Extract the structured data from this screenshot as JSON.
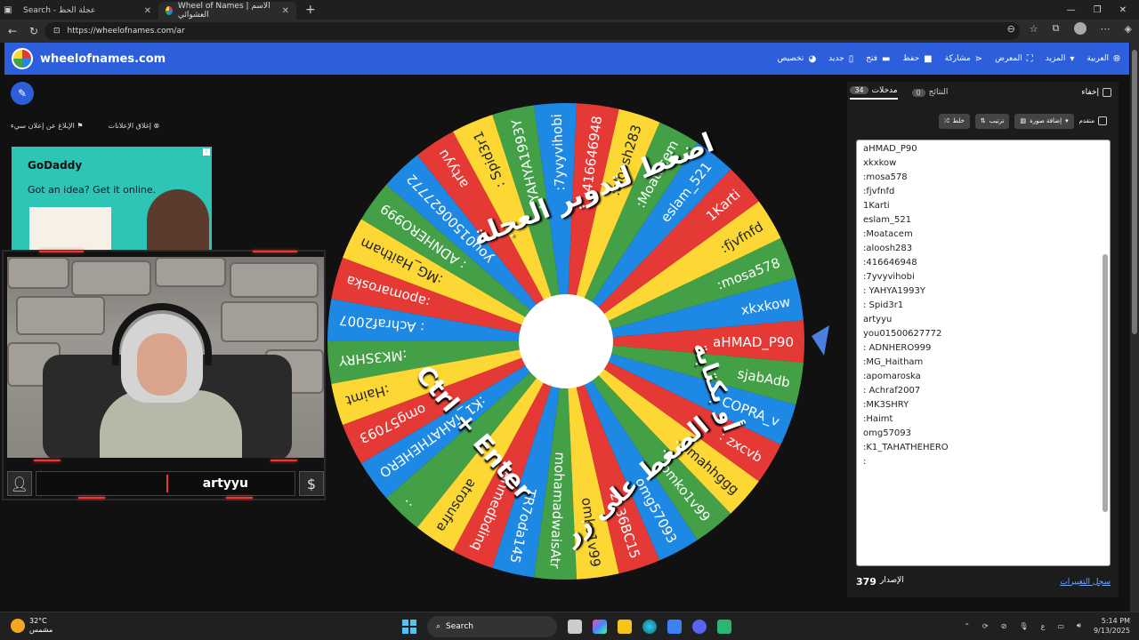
{
  "browser": {
    "tab1_title": "Search - عجلة الحظ",
    "tab2_title": "Wheel of Names | الاسم العشوائي",
    "url": "https://wheelofnames.com/ar"
  },
  "header": {
    "brand": "wheelofnames.com",
    "menu": {
      "language": "العربية",
      "more": "المزيد",
      "gallery": "المعرض",
      "share": "مشاركة",
      "save": "حفظ",
      "open": "فتح",
      "new": "جديد",
      "customize": "تخصيص"
    }
  },
  "ads": {
    "close_ads": "إغلاق الإعلانات",
    "report_ad": "الإبلاغ عن إعلان سيء",
    "brand": "GoDaddy",
    "tagline": "Got an idea? Get it online."
  },
  "stream": {
    "username": "artyyu",
    "currency_icon": "$"
  },
  "wheel": {
    "colors": [
      "#e53935",
      "#1e88e5",
      "#43a047",
      "#fdd835"
    ],
    "segments": [
      "aHMAD_P90",
      "xkxkow",
      ":mosa578",
      ":fjvfnfd",
      "1Karti",
      "eslam_521",
      ":Moatacem",
      ":aloosh283",
      ":416646948",
      ":7yvyvihobi",
      ": YAHYA1993Y",
      ": Spid3r1",
      "artyyu",
      "you01500627772",
      ": ADNHERO999",
      ":MG_Haitham",
      ":apomaroska",
      ": Achraf2007",
      ":MK3SHRY",
      ":Haimt",
      "omg57093",
      ":K1_TAHATHEHERO",
      ":",
      "atrosufra",
      "Ahmedbdinq",
      "TR7oda145",
      "mohamadwaisAtr",
      "omko1v99",
      "2136BC15",
      "omg57093",
      "omko1v99",
      "omahhggg",
      ": zxcvb",
      "COPRA_v",
      "sjabAdb"
    ],
    "overlay_line1": "اضغط لتدوير العجلة",
    "overlay_line2": "أو بكتابة",
    "overlay_line3": "الضغط على زر",
    "overlay_keys": "Ctrl + Enter"
  },
  "panel": {
    "hide_label": "إخفاء",
    "results_tab": "النتائج",
    "results_count": "0",
    "entries_tab": "مدخلات",
    "entries_count": "34",
    "shuffle": "خلط",
    "sort": "ترتيب",
    "add_image": "إضافة صورة",
    "advanced": "متقدم",
    "entries": [
      "aHMAD_P90",
      "xkxkow",
      ":mosa578",
      ":fjvfnfd",
      "1Karti",
      "eslam_521",
      ":Moatacem",
      ":aloosh283",
      ":416646948",
      ":7yvyvihobi",
      ": YAHYA1993Y",
      ": Spid3r1",
      "artyyu",
      "you01500627772",
      ": ADNHERO999",
      ":MG_Haitham",
      ":apomaroska",
      ": Achraf2007",
      ":MK3SHRY",
      ":Haimt",
      "omg57093",
      ":K1_TAHATHEHERO",
      ":"
    ],
    "changelog": "سجل التغييرات",
    "version_label": "الإصدار",
    "version": "379"
  },
  "taskbar": {
    "temperature": "32°C",
    "weather": "مشمس",
    "search": "Search",
    "time": "5:14 PM",
    "date": "9/13/2025",
    "lang": "ع"
  }
}
